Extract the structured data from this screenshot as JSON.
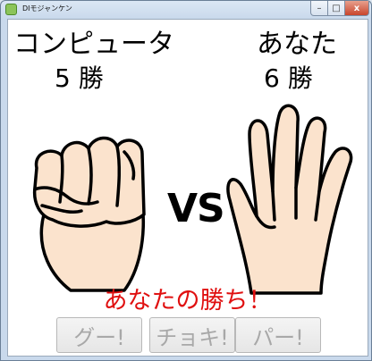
{
  "window": {
    "title": "DIモジャンケン",
    "minimize_glyph": "–",
    "maximize_glyph": "□",
    "close_glyph": "x"
  },
  "computer": {
    "name": "コンピュータ",
    "wins": "5 勝"
  },
  "player": {
    "name": "あなた",
    "wins": "6 勝"
  },
  "vs_label": "VS",
  "result": "あなたの勝ち！",
  "buttons": {
    "rock": "グー!",
    "scissors": "チョキ!",
    "paper": "パー!"
  },
  "colors": {
    "skin": "#fbe3cd",
    "result": "#e01010"
  }
}
